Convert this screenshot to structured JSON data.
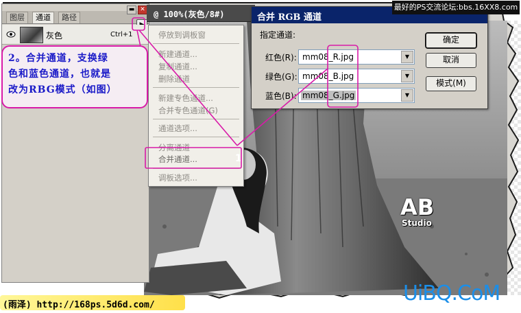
{
  "top_watermark": "最好的PS交流论坛:bbs.16XX8.com",
  "bottom_watermark": "(雨泽) http://168ps.5d6d.com/",
  "site_logo": "UiBQ.CoM",
  "photo": {
    "logo_main": "AB",
    "logo_sub": "Studio"
  },
  "panel": {
    "tabs": [
      "图层",
      "通道",
      "路径"
    ],
    "active_tab": "通道",
    "channel": {
      "name": "灰色",
      "shortcut": "Ctrl+1"
    }
  },
  "document": {
    "title": "@ 100%(灰色/8#)"
  },
  "annotation": {
    "lines": [
      "2。合并通道，支换绿",
      "色和蓝色通道，也就是",
      "改为RBG模式（如图）"
    ]
  },
  "flyout_menu": {
    "items": [
      "停放到调板窗",
      "新建通道...",
      "复制通道...",
      "删除通道",
      "新建专色通道...",
      "合并专色通道(G)",
      "通道选项...",
      "分离通道",
      "合并通道...",
      "调板选项..."
    ],
    "highlighted": "合并通道...",
    "badge": "1"
  },
  "dialog": {
    "title": "合并 RGB 通道",
    "group_label": "指定通道:",
    "channels": [
      {
        "label": "红色(R):",
        "value": "mm08_R.jpg"
      },
      {
        "label": "绿色(G):",
        "value": "mm08_B.jpg"
      },
      {
        "label": "蓝色(B):",
        "value": "mm08_G.jpg"
      }
    ],
    "buttons": {
      "ok": "确定",
      "cancel": "取消",
      "mode": "模式(M)"
    }
  },
  "colors": {
    "callout": "#d81aa8",
    "annotation_text": "#1a1ac8",
    "dialog_titlebar": "#0a246a",
    "logo_blue": "#1b8ee8"
  },
  "icons": [
    "eye-icon",
    "panel-menu-arrow-icon",
    "minimize-icon",
    "close-icon",
    "dropdown-arrow-icon"
  ]
}
